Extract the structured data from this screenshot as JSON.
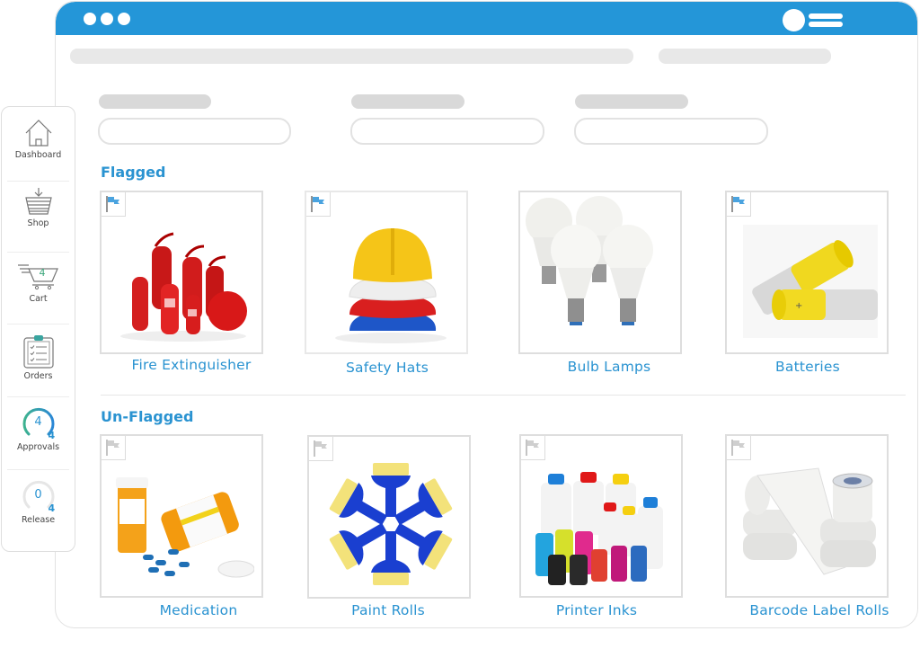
{
  "window": {
    "titlebar_color": "#2496d8",
    "window_controls": [
      "dot",
      "dot",
      "dot"
    ],
    "user_menu_icon": "user-menu-icon"
  },
  "sidebar": {
    "items": [
      {
        "label": "Dashboard",
        "icon": "home-icon"
      },
      {
        "label": "Shop",
        "icon": "basket-icon"
      },
      {
        "label": "Cart",
        "icon": "cart-icon",
        "badge": "4"
      },
      {
        "label": "Orders",
        "icon": "clipboard-icon"
      },
      {
        "label": "Approvals",
        "icon": "gauge-icon",
        "value": "4",
        "max": "4"
      },
      {
        "label": "Release",
        "icon": "gauge-icon",
        "value": "0",
        "max": "4"
      }
    ]
  },
  "sections": {
    "flagged": {
      "title": "Flagged",
      "items": [
        {
          "label": "Fire Extinguisher",
          "flagged": true
        },
        {
          "label": "Safety Hats",
          "flagged": true
        },
        {
          "label": "Bulb Lamps",
          "flagged": false
        },
        {
          "label": "Batteries",
          "flagged": true
        }
      ]
    },
    "unflagged": {
      "title": "Un-Flagged",
      "items": [
        {
          "label": "Medication",
          "flagged": false
        },
        {
          "label": "Paint Rolls",
          "flagged": false
        },
        {
          "label": "Printer Inks",
          "flagged": false
        },
        {
          "label": "Barcode Label Rolls",
          "flagged": false
        }
      ]
    }
  },
  "colors": {
    "accent": "#2a93d1",
    "flag_active": "#4aa3df",
    "flag_inactive": "#c8c8c8"
  }
}
